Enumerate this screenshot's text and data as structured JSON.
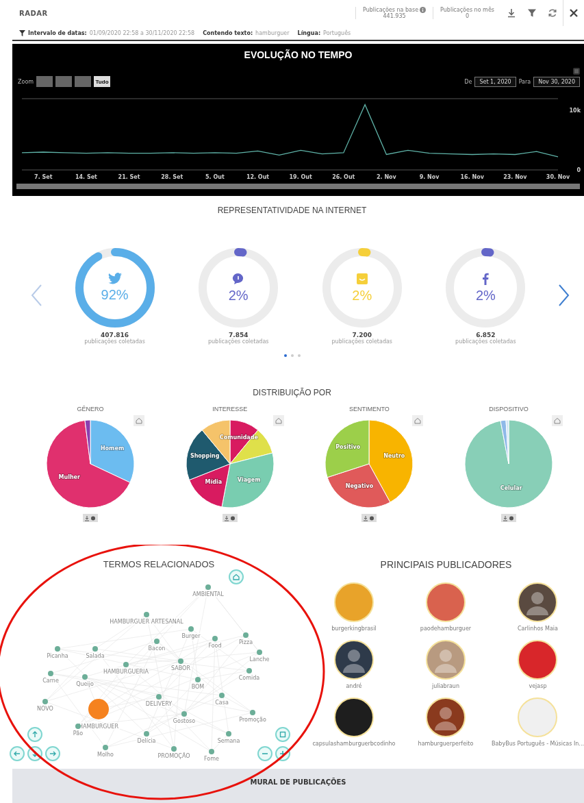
{
  "header": {
    "title": "RADAR",
    "stats": [
      {
        "label": "Publicações na base",
        "value": "441.935",
        "info": true
      },
      {
        "label": "Publicações no mês",
        "value": "0",
        "info": false
      }
    ]
  },
  "filters": [
    {
      "label": "Intervalo de datas:",
      "value": "01/09/2020 22:58 a 30/11/2020 22:58"
    },
    {
      "label": "Contendo texto:",
      "value": "hamburguer"
    },
    {
      "label": "Língua:",
      "value": "Português"
    }
  ],
  "timeline": {
    "title": "EVOLUÇÃO NO TEMPO",
    "zoom_label": "Zoom",
    "zoom_buttons": [
      {
        "selected": false
      },
      {
        "selected": false
      },
      {
        "selected": false
      },
      {
        "label": "Tudo",
        "selected": true
      }
    ],
    "from_label": "De",
    "from": "Set 1, 2020",
    "to_label": "Para",
    "to": "Nov 30, 2020",
    "chart_data": {
      "type": "line",
      "categories": [
        null,
        "7. Set",
        null,
        "14. Set",
        null,
        "21. Set",
        null,
        "28. Set",
        null,
        "5. Out",
        null,
        "12. Out",
        null,
        "19. Out",
        null,
        "26. Out",
        null,
        "2. Nov",
        null,
        "9. Nov",
        null,
        "16. Nov",
        null,
        "23. Nov",
        null,
        "30. Nov"
      ],
      "values": [
        2900,
        3000,
        2900,
        2800,
        2900,
        2800,
        2800,
        2900,
        2800,
        2900,
        2800,
        3200,
        2500,
        3300,
        2700,
        2900,
        11000,
        2600,
        3300,
        2800,
        2700,
        2600,
        2700,
        2600,
        3100,
        2200
      ],
      "ylim": [
        0,
        12000
      ],
      "yticks": [
        0,
        {
          "value": 10000,
          "label": "10k"
        }
      ]
    }
  },
  "representation": {
    "title": "REPRESENTATIVIDADE NA INTERNET",
    "channels": [
      {
        "kind": "twitter",
        "percent": "92%",
        "level": 0.92,
        "count": "407.816",
        "caption": "publicações coletadas",
        "color": "#5aaee8"
      },
      {
        "kind": "chat",
        "percent": "2%",
        "level": 0.02,
        "count": "7.854",
        "caption": "publicações coletadas",
        "color": "#6366c8"
      },
      {
        "kind": "box",
        "percent": "2%",
        "level": 0.02,
        "count": "7.200",
        "caption": "publicações coletadas",
        "color": "#f5cf3a"
      },
      {
        "kind": "facebook",
        "percent": "2%",
        "level": 0.02,
        "count": "6.852",
        "caption": "publicações coletadas",
        "color": "#6366c8"
      }
    ],
    "pages": [
      {
        "selected": true
      },
      {
        "selected": false
      },
      {
        "selected": false
      }
    ]
  },
  "distribution": {
    "title": "DISTRIBUIÇÃO POR",
    "charts": [
      {
        "title": "GÊNERO",
        "chart_data": {
          "type": "pie",
          "categories": [
            "Homem",
            "Mulher",
            null
          ],
          "values": [
            32,
            66,
            2
          ],
          "colors": [
            "#6cbcf0",
            "#e0306e",
            "#8a3fb0"
          ]
        }
      },
      {
        "title": "INTERESSE",
        "chart_data": {
          "type": "pie",
          "categories": [
            "Comunidade",
            null,
            "Viagem",
            "Mídia",
            "Shopping",
            null
          ],
          "values": [
            11,
            10,
            32,
            16,
            20,
            11
          ],
          "colors": [
            "#d81b60",
            "#dfe04a",
            "#79cdb0",
            "#d81b60",
            "#1f5a6e",
            "#f5c36a"
          ]
        }
      },
      {
        "title": "SENTIMENTO",
        "chart_data": {
          "type": "pie",
          "categories": [
            "Neutro",
            "Negativo",
            "Positivo"
          ],
          "values": [
            42,
            28,
            30
          ],
          "colors": [
            "#f8b400",
            "#e05a5a",
            "#9ccf4a"
          ]
        }
      },
      {
        "title": "DISPOSITIVO",
        "chart_data": {
          "type": "pie",
          "categories": [
            "Celular",
            null,
            null
          ],
          "values": [
            97,
            2,
            1
          ],
          "colors": [
            "#88cfb7",
            "#8eb9e8",
            "#d0e6f5"
          ]
        }
      }
    ]
  },
  "related_terms": {
    "title": "TERMOS RELACIONADOS",
    "nodes": [
      "HAMBURGUER",
      "AMBIENTAL",
      "HAMBURGUER ARTESANAL",
      "Burger",
      "Bacon",
      "Food",
      "Pizza",
      "Salada",
      "Picanha",
      "Carne",
      "Queijo",
      "HAMBURGUERIA",
      "SABOR",
      "BOM",
      "Casa",
      "DELIVERY",
      "Gostoso",
      "NOVO",
      "Comida",
      "Promoção",
      "Semana",
      "Pão",
      "PROMOÇÃO",
      "Delícia",
      "Molho",
      "Fome",
      "Lanche"
    ]
  },
  "publishers": {
    "title": "PRINCIPAIS PUBLICADORES",
    "items": [
      {
        "name": "burgerkingbrasil",
        "kind": "logo",
        "color": "#e8a32a"
      },
      {
        "name": "paodehamburguer",
        "kind": "logo",
        "color": "#d9624e"
      },
      {
        "name": "Carlinhos Maia",
        "kind": "person",
        "color": "#5a4a40"
      },
      {
        "name": "andré",
        "kind": "person",
        "color": "#2e3a4a"
      },
      {
        "name": "juliabraun",
        "kind": "person",
        "color": "#b89a80"
      },
      {
        "name": "vejasp",
        "kind": "logo",
        "color": "#d8262a"
      },
      {
        "name": "capsulashamburguerbcodinho",
        "kind": "logo",
        "color": "#1e1e1e"
      },
      {
        "name": "hamburguerperfeito",
        "kind": "person",
        "color": "#8a3a1e"
      },
      {
        "name": "BabyBus Português - Músicas In...",
        "kind": "logo",
        "color": "#f0f0f0"
      }
    ]
  },
  "mural": {
    "title": "MURAL DE PUBLICAÇÕES"
  }
}
